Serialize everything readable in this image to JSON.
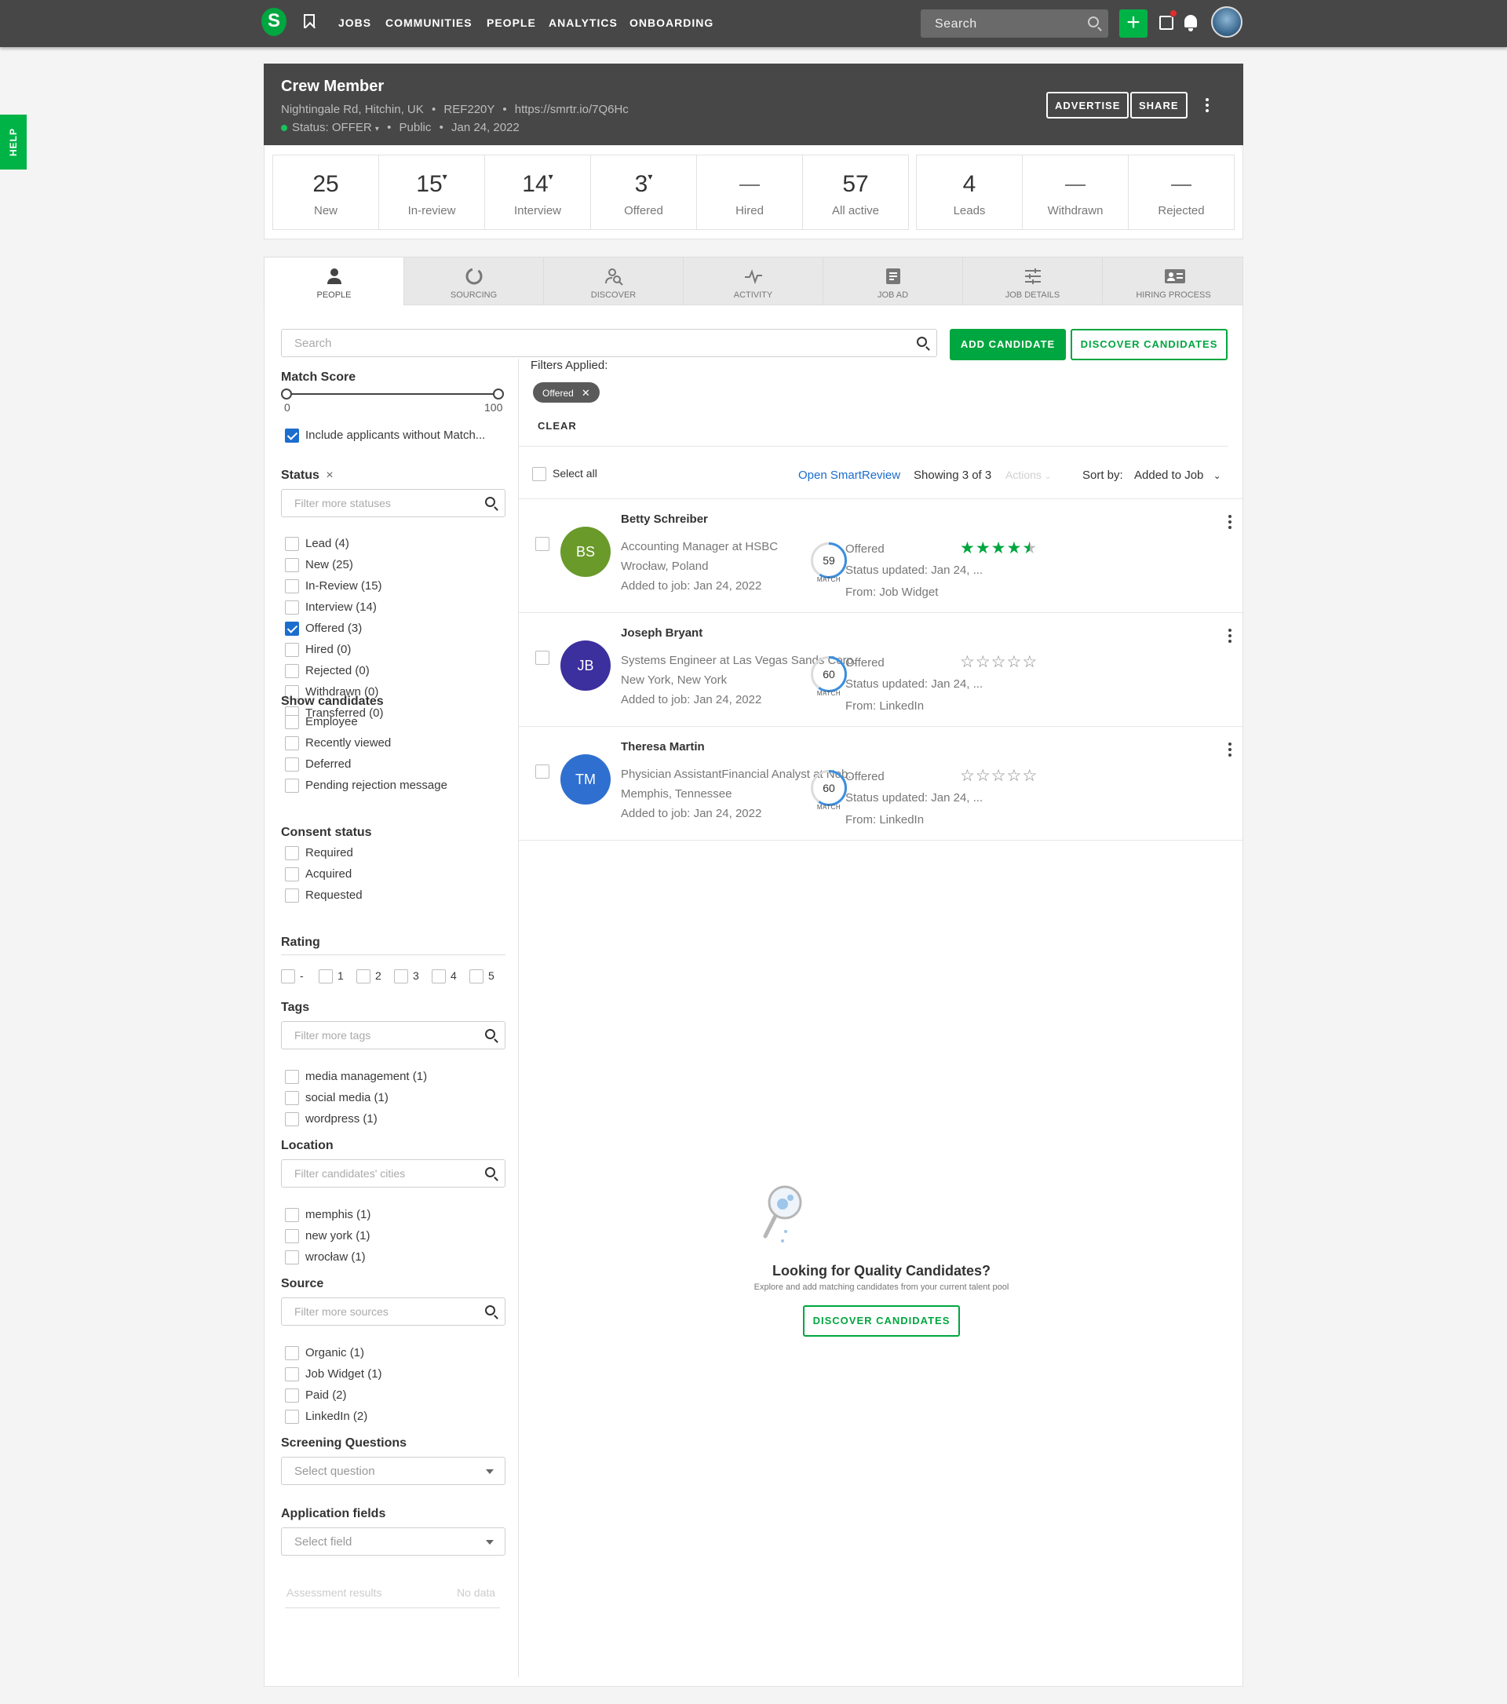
{
  "topbar": {
    "logo": "S",
    "nav": [
      "JOBS",
      "COMMUNITIES",
      "PEOPLE",
      "ANALYTICS",
      "ONBOARDING"
    ],
    "search_placeholder": "Search"
  },
  "help": "HELP",
  "job": {
    "title": "Crew Member",
    "location": "Nightingale Rd, Hitchin, UK",
    "ref": "REF220Y",
    "link": "https://smrtr.io/7Q6Hc",
    "status_label": "Status:",
    "status": "OFFER",
    "visibility": "Public",
    "date": "Jan 24, 2022",
    "advertise": "ADVERTISE",
    "share": "SHARE"
  },
  "stats": [
    {
      "num": "25",
      "label": "New",
      "caret": false
    },
    {
      "num": "15",
      "label": "In-review",
      "caret": true
    },
    {
      "num": "14",
      "label": "Interview",
      "caret": true
    },
    {
      "num": "3",
      "label": "Offered",
      "caret": true
    },
    {
      "num": "",
      "label": "Hired",
      "caret": false
    },
    {
      "num": "57",
      "label": "All active",
      "caret": false
    },
    {
      "num": "4",
      "label": "Leads",
      "caret": false
    },
    {
      "num": "",
      "label": "Withdrawn",
      "caret": false
    },
    {
      "num": "",
      "label": "Rejected",
      "caret": false
    }
  ],
  "tabs": [
    "PEOPLE",
    "SOURCING",
    "DISCOVER",
    "ACTIVITY",
    "JOB AD",
    "JOB DETAILS",
    "HIRING PROCESS"
  ],
  "search": {
    "placeholder": "Search"
  },
  "buttons": {
    "add": "ADD CANDIDATE",
    "discover": "DISCOVER CANDIDATES"
  },
  "filters": {
    "match_title": "Match Score",
    "match_min": "0",
    "match_max": "100",
    "include_label": "Include applicants without Match...",
    "status_title": "Status",
    "status_clear": "×",
    "status_placeholder": "Filter more statuses",
    "statuses": [
      {
        "label": "Lead (4)",
        "checked": false
      },
      {
        "label": "New (25)",
        "checked": false
      },
      {
        "label": "In-Review (15)",
        "checked": false
      },
      {
        "label": "Interview (14)",
        "checked": false
      },
      {
        "label": "Offered (3)",
        "checked": true
      },
      {
        "label": "Hired (0)",
        "checked": false
      },
      {
        "label": "Rejected (0)",
        "checked": false
      },
      {
        "label": "Withdrawn (0)",
        "checked": false
      },
      {
        "label": "Transferred (0)",
        "checked": false
      }
    ],
    "show_title": "Show candidates",
    "show": [
      "Employee",
      "Recently viewed",
      "Deferred",
      "Pending rejection message"
    ],
    "consent_title": "Consent status",
    "consent": [
      "Required",
      "Acquired",
      "Requested"
    ],
    "rating_title": "Rating",
    "ratings": [
      "-",
      "1",
      "2",
      "3",
      "4",
      "5"
    ],
    "tags_title": "Tags",
    "tags_placeholder": "Filter more tags",
    "tags": [
      "media management (1)",
      "social media (1)",
      "wordpress (1)"
    ],
    "location_title": "Location",
    "location_placeholder": "Filter candidates' cities",
    "locations": [
      "memphis (1)",
      "new york (1)",
      "wrocław (1)"
    ],
    "source_title": "Source",
    "source_placeholder": "Filter more sources",
    "sources": [
      "Organic (1)",
      "Job Widget (1)",
      "Paid (2)",
      "LinkedIn (2)"
    ],
    "screening_title": "Screening Questions",
    "screening_placeholder": "Select question",
    "appfields_title": "Application fields",
    "appfields_placeholder": "Select field",
    "assessment_label": "Assessment results",
    "assessment_value": "No data"
  },
  "applied": {
    "title": "Filters Applied:",
    "chip": "Offered",
    "clear": "CLEAR"
  },
  "listbar": {
    "select_all": "Select all",
    "smartreview": "Open SmartReview",
    "showing": "Showing 3 of 3",
    "actions": "Actions",
    "sort_label": "Sort by:",
    "sort_value": "Added to Job"
  },
  "candidates": [
    {
      "initials": "BS",
      "color": "#6a9a2a",
      "name": "Betty Schreiber",
      "line1": "Accounting Manager at HSBC",
      "line2": "Wrocław, Poland",
      "line3": "Added to job: Jan 24, 2022",
      "match": "59",
      "match_label": "MATCH",
      "status": "Offered",
      "updated": "Status updated: Jan 24, ...",
      "from": "From: Job Widget",
      "rating": 4.5
    },
    {
      "initials": "JB",
      "color": "#3c2f9e",
      "name": "Joseph Bryant",
      "line1": "Systems Engineer at Las Vegas Sands Corp.",
      "line2": "New York, New York",
      "line3": "Added to job: Jan 24, 2022",
      "match": "60",
      "match_label": "MATCH",
      "status": "Offered",
      "updated": "Status updated: Jan 24, ...",
      "from": "From: LinkedIn",
      "rating": 0
    },
    {
      "initials": "TM",
      "color": "#2f6fcf",
      "name": "Theresa Martin",
      "line1": "Physician AssistantFinancial Analyst at Nob...",
      "line2": "Memphis, Tennessee",
      "line3": "Added to job: Jan 24, 2022",
      "match": "60",
      "match_label": "MATCH",
      "status": "Offered",
      "updated": "Status updated: Jan 24, ...",
      "from": "From: LinkedIn",
      "rating": 0
    }
  ],
  "empty": {
    "title": "Looking for Quality Candidates?",
    "subtitle": "Explore and add matching candidates from your current talent pool",
    "button": "DISCOVER CANDIDATES"
  }
}
